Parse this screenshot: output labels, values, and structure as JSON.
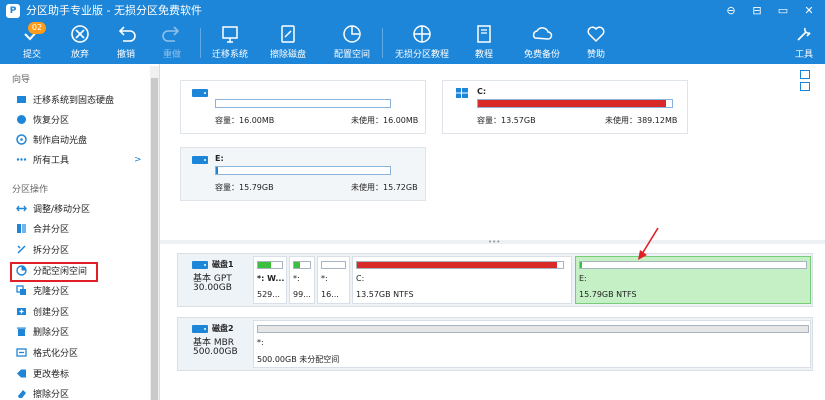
{
  "app": {
    "title": "分区助手专业版 - 无损分区免费软件",
    "window_controls": [
      "⊖",
      "⊟",
      "▭",
      "✕"
    ]
  },
  "toolbar": {
    "pending_badge": "02",
    "buttons": [
      {
        "label": "提交",
        "icon": "check-icon"
      },
      {
        "label": "放弃",
        "icon": "discard-icon"
      },
      {
        "label": "撤销",
        "icon": "undo-icon"
      },
      {
        "label": "重做",
        "icon": "redo-icon"
      },
      {
        "label": "迁移系统",
        "icon": "migrate-os-icon"
      },
      {
        "label": "擦除磁盘",
        "icon": "wipe-disk-icon"
      },
      {
        "label": "配置空间",
        "icon": "allocate-space-icon"
      },
      {
        "label": "无损分区教程",
        "icon": "tutorial-icon"
      },
      {
        "label": "教程",
        "icon": "book-icon"
      },
      {
        "label": "免费备份",
        "icon": "backup-icon"
      },
      {
        "label": "赞助",
        "icon": "sponsor-icon"
      },
      {
        "label": "工具",
        "icon": "tools-icon"
      }
    ]
  },
  "sidebar": {
    "wizard_header": "向导",
    "wizard_items": [
      "迁移系统到固态硬盘",
      "恢复分区",
      "制作启动光盘",
      "所有工具"
    ],
    "all_tools_arrow": ">",
    "ops_header": "分区操作",
    "ops_items": [
      "调整/移动分区",
      "合并分区",
      "拆分分区",
      "分配空闲空间",
      "克隆分区",
      "创建分区",
      "删除分区",
      "格式化分区",
      "更改卷标",
      "擦除分区"
    ]
  },
  "partitions_view": {
    "cards": [
      {
        "name": "",
        "capacity": "容量：16.00MB",
        "free": "未使用：16.00MB",
        "used_fraction": 0.0,
        "fill_color": "#1e86d8"
      },
      {
        "name": "C:",
        "capacity": "容量：13.57GB",
        "free": "未使用：389.12MB",
        "used_fraction": 0.97,
        "fill_color": "#d92a2a"
      },
      {
        "name": "E:",
        "capacity": "容量：15.79GB",
        "free": "未使用：15.72GB",
        "used_fraction": 0.005,
        "fill_color": "#1e86d8"
      }
    ]
  },
  "disks": [
    {
      "name": "磁盘1",
      "type": "基本 GPT",
      "size": "30.00GB",
      "partitions": [
        {
          "label": "*: W...",
          "size": "529...",
          "used_fraction": 0.55,
          "fill_color": "#3cbf3c"
        },
        {
          "label": "*:",
          "size": "99...",
          "used_fraction": 0.4,
          "fill_color": "#3cbf3c"
        },
        {
          "label": "*:",
          "size": "16...",
          "used_fraction": 0.0,
          "fill_color": "#3cbf3c"
        },
        {
          "label": "C:",
          "size": "13.57GB NTFS",
          "used_fraction": 0.97,
          "fill_color": "#d92a2a"
        },
        {
          "label": "E:",
          "size": "15.79GB NTFS",
          "used_fraction": 0.01,
          "fill_color": "#3cbf3c"
        }
      ]
    },
    {
      "name": "磁盘2",
      "type": "基本 MBR",
      "size": "500.00GB",
      "partitions": [
        {
          "label": "*:",
          "size": "500.00GB 未分配空间",
          "used_fraction": 0.0,
          "fill_color": "#dddddd"
        }
      ]
    }
  ],
  "colors": {
    "accent": "#1e86d8",
    "selected_partition": "#c5f0c5",
    "annotation": "#e11f26"
  }
}
